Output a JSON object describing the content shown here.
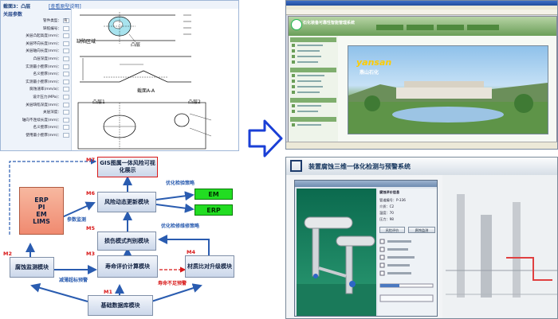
{
  "form": {
    "title": "截面3：凸层",
    "link": "[查看原型说明]",
    "section": "关层参数",
    "fields": [
      {
        "label": "管件类型：",
        "value": "弯"
      },
      {
        "label": "缺陷编号："
      },
      {
        "label": "关层凸起高度(mm)："
      },
      {
        "label": "关层环向长度(mm)："
      },
      {
        "label": "关层轴向长度(mm)："
      },
      {
        "label": "凸层深度(mm)："
      },
      {
        "label": "实测最小壁厚(mm)："
      },
      {
        "label": "名义壁厚(mm)："
      },
      {
        "label": "实测最小壁厚(mm)："
      },
      {
        "label": "腐蚀速率(mm/a)："
      },
      {
        "label": "设计压力(MPa)："
      },
      {
        "label": "关层缺陷深度(mm)："
      },
      {
        "label": "关层深度："
      },
      {
        "label": "轴向不连续长度(mm)："
      },
      {
        "label": "名义壁厚(mm)："
      },
      {
        "label": "使用最小壁厚(mm)："
      }
    ],
    "diagram": {
      "defect_area": "缺陷区域",
      "bulge": "凸层",
      "section": "截面A-A",
      "bulge1": "凸层1",
      "bulge2": "凸层2"
    }
  },
  "flow": {
    "gis": "GIS图属一体风险可视化展示",
    "systems": [
      "ERP",
      "PI",
      "EM",
      "LIMS"
    ],
    "risk": "风险动态更新模块",
    "damage": "损伤模式判别模块",
    "life": "寿命评价计算模块",
    "material": "材质比对升级模块",
    "corrosion": "腐蚀监测模块",
    "database": "基础数据库模块",
    "em": "EM",
    "erp": "ERP",
    "m_labels": [
      "M1",
      "M2",
      "M3",
      "M4",
      "M5",
      "M6",
      "M7"
    ],
    "edges": {
      "param_monitor": "参数监测",
      "opt_inspect": "优化检验策略",
      "opt_repair": "优化检修维修策略",
      "thin_warning": "减薄超标预警",
      "life_warning": "寿命不足预警"
    }
  },
  "web": {
    "app_title": "石化装备可靠性智能管理系统",
    "brand": "yansan",
    "brand_cn": "燕山石化"
  },
  "app": {
    "title": "装置腐蚀三维一体化检测与预警系统",
    "panel_title": "腐蚀评价信息",
    "props": [
      {
        "label": "管道编号",
        "value": "P-336"
      },
      {
        "label": "介质",
        "value": "C2"
      },
      {
        "label": "温度",
        "value": "70"
      },
      {
        "label": "压力",
        "value": "98"
      }
    ],
    "buttons": [
      "风险评价",
      "腐蚀监测"
    ]
  },
  "colors": {
    "arrow": "#1a3fd6",
    "flow_blue": "#2a5cb0",
    "warning_red": "#d81818",
    "green_box": "#22dd22"
  }
}
